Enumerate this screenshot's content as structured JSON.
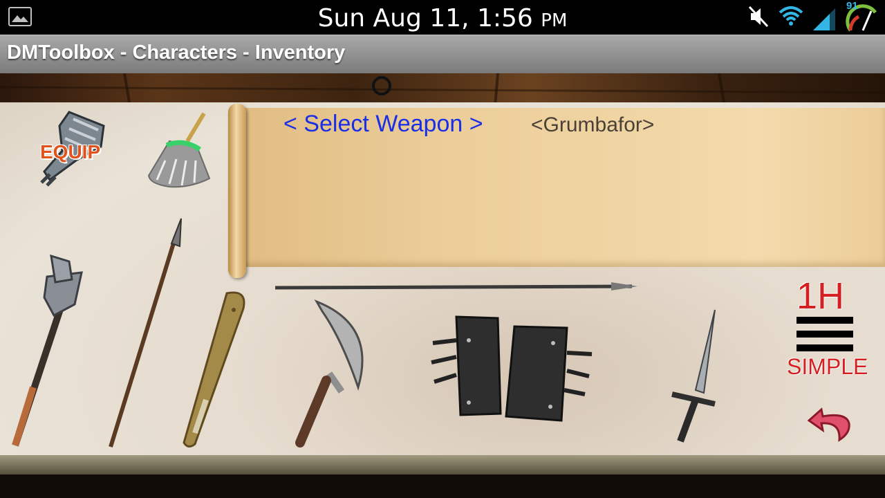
{
  "status_bar": {
    "time": "Sun Aug 11, 1:56",
    "ampm": "PM",
    "battery_level": "91",
    "icons": [
      "gallery-icon",
      "mute-icon",
      "wifi-icon",
      "signal-icon",
      "battery-gauge-icon"
    ]
  },
  "app": {
    "title": "DMToolbox - Characters - Inventory"
  },
  "scroll": {
    "select_weapon": "< Select Weapon >",
    "character_name": "<Grumbafor>"
  },
  "toolbar": {
    "equip_label": "EQUIP",
    "equip_icon": "equip-gauntlet-icon",
    "clear_icon": "broom-icon"
  },
  "weapons": [
    {
      "name": "mace",
      "icon": "mace-icon"
    },
    {
      "name": "spear",
      "icon": "spear-icon"
    },
    {
      "name": "club",
      "icon": "club-icon"
    },
    {
      "name": "sickle",
      "icon": "sickle-icon"
    },
    {
      "name": "gauntlets",
      "icon": "gauntlets-icon"
    },
    {
      "name": "dagger",
      "icon": "dagger-icon"
    },
    {
      "name": "javelin",
      "icon": "javelin-icon"
    }
  ],
  "filters": {
    "handedness": "1H",
    "category": "SIMPLE",
    "menu_icon": "menu-lines-icon",
    "back_icon": "return-arrow-icon"
  },
  "colors": {
    "select_weapon": "#1a2ee6",
    "filter_text": "#d42020",
    "equip_text": "#e0531c"
  }
}
